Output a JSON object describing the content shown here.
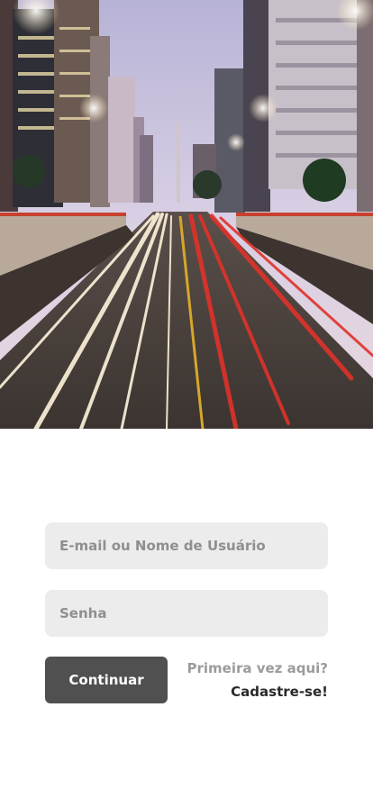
{
  "login": {
    "email_placeholder": "E-mail ou Nome de Usuário",
    "password_placeholder": "Senha",
    "continue_label": "Continuar",
    "first_time_text": "Primeira vez aqui?",
    "signup_label": "Cadastre-se!"
  },
  "colors": {
    "field_background": "#ececec",
    "placeholder_text": "#8f8f8f",
    "button_background": "#505050",
    "muted_text": "#9b9b9b",
    "link_text": "#2a2a2a"
  }
}
